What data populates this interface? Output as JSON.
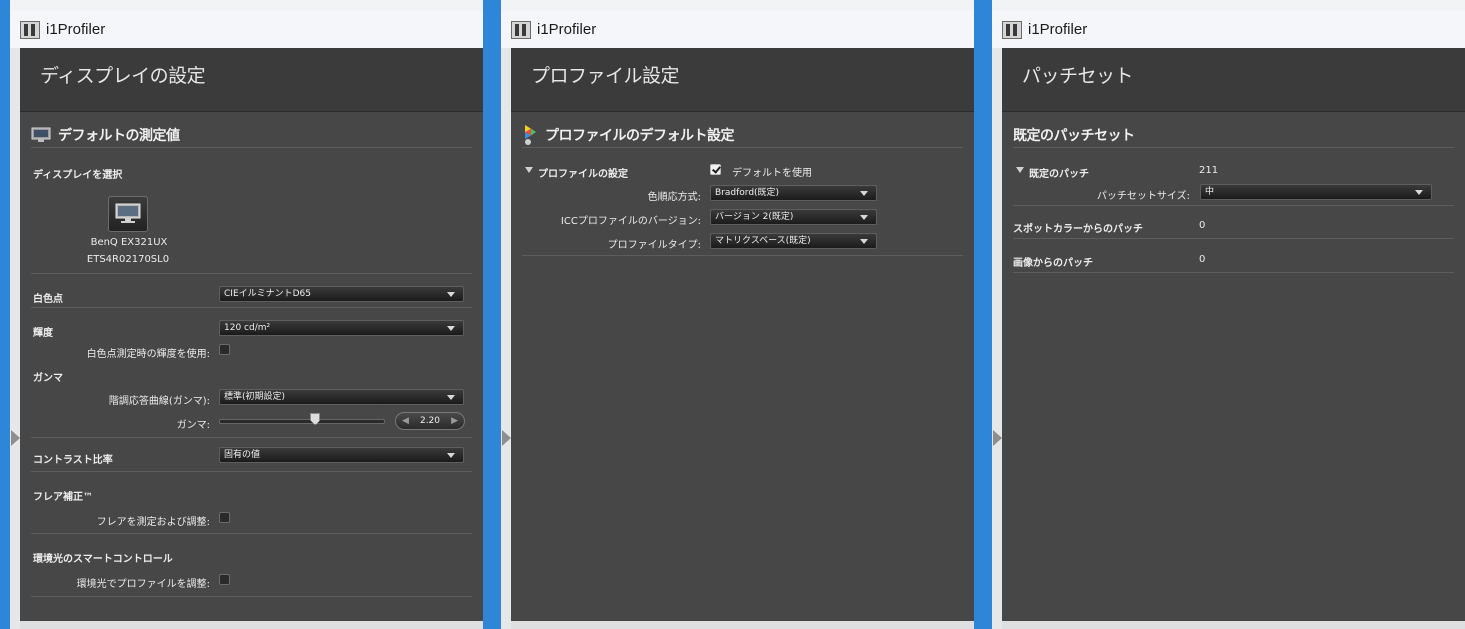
{
  "windows": [
    {
      "app_title": "i1Profiler",
      "header": "ディスプレイの設定",
      "section_title": "デフォルトの測定値",
      "select_display_label": "ディスプレイを選択",
      "display_name": "BenQ EX321UX",
      "display_serial": "ETS4R02170SL0",
      "white_point": {
        "label": "白色点",
        "value": "CIEイルミナントD65"
      },
      "luminance": {
        "label": "輝度",
        "value": "120 cd/m²",
        "checkbox_label": "白色点測定時の輝度を使用:"
      },
      "gamma": {
        "label": "ガンマ",
        "curve_label": "階調応答曲線(ガンマ):",
        "curve_value": "標準(初期設定)",
        "slider_label": "ガンマ:",
        "value": "2.20",
        "slider_fraction": 0.58
      },
      "contrast": {
        "label": "コントラスト比率",
        "value": "固有の値"
      },
      "flare": {
        "label": "フレア補正™",
        "checkbox_label": "フレアを測定および調整:"
      },
      "ambient": {
        "label": "環境光のスマートコントロール",
        "checkbox_label": "環境光でプロファイルを調整:"
      }
    },
    {
      "app_title": "i1Profiler",
      "header": "プロファイル設定",
      "section_title": "プロファイルのデフォルト設定",
      "group_label": "プロファイルの設定",
      "use_default_label": "デフォルトを使用",
      "rows": [
        {
          "label": "色順応方式:",
          "value": "Bradford(既定)"
        },
        {
          "label": "ICCプロファイルのバージョン:",
          "value": "バージョン 2(既定)"
        },
        {
          "label": "プロファイルタイプ:",
          "value": "マトリクスベース(既定)"
        }
      ]
    },
    {
      "app_title": "i1Profiler",
      "header": "パッチセット",
      "section_title": "既定のパッチセット",
      "default_patches": {
        "label": "既定のパッチ",
        "value": "211"
      },
      "patch_size": {
        "label": "パッチセットサイズ:",
        "value": "中"
      },
      "spot_patches": {
        "label": "スポットカラーからのパッチ",
        "value": "0"
      },
      "image_patches": {
        "label": "画像からのパッチ",
        "value": "0"
      }
    }
  ]
}
